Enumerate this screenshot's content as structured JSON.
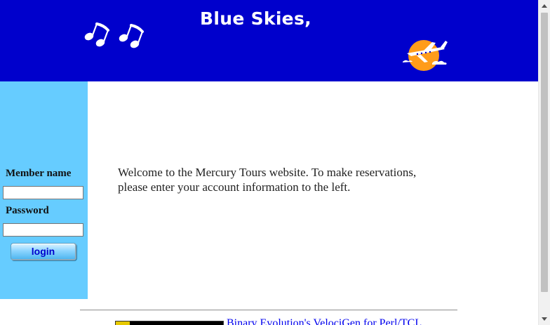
{
  "header": {
    "title": "Blue Skies,",
    "background_color": "#0000cc",
    "left_icon": "music-notes-icon",
    "right_icon": "airplane-sun-icon"
  },
  "sidebar": {
    "background_color": "#66ccff",
    "member_name_label": "Member name",
    "member_name_value": "",
    "password_label": "Password",
    "password_value": "",
    "login_label": "login"
  },
  "main": {
    "welcome_text": "Welcome to the Mercury Tours website. To make reservations, please enter your account information to the left."
  },
  "footer": {
    "link_text": "Binary Evolution's VelociGen for Perl/TCL",
    "badge_icon": "velocigen-badge-icon"
  },
  "scrollbar": {
    "up_icon": "scroll-up-arrow-icon",
    "down_icon": "scroll-down-arrow-icon"
  }
}
